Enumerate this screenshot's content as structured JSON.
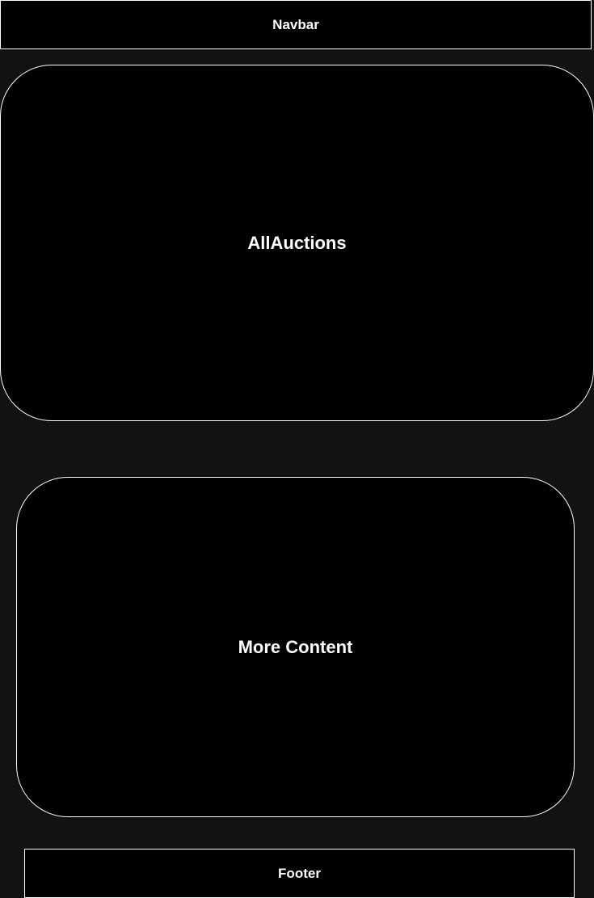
{
  "navbar": {
    "label": "Navbar"
  },
  "all_auctions": {
    "label": "AllAuctions"
  },
  "more_content": {
    "label": "More Content"
  },
  "footer": {
    "label": "Footer"
  },
  "colors": {
    "background": "#121212",
    "box_fill": "#000000",
    "box_border": "#ffffff",
    "text": "#ffffff"
  }
}
